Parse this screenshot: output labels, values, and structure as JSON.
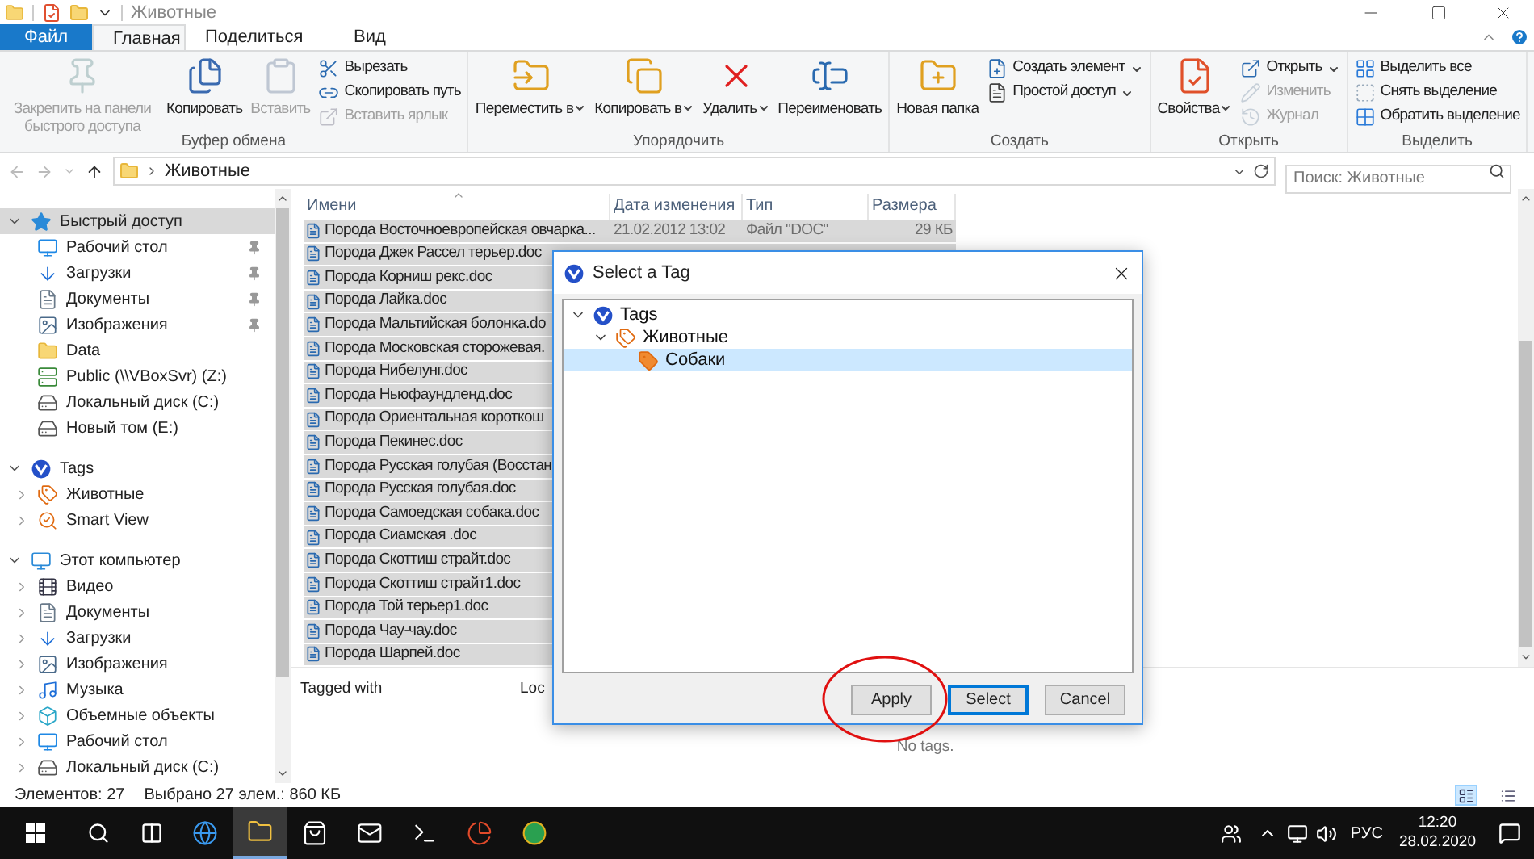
{
  "window": {
    "title": "Животные"
  },
  "tabs": [
    {
      "label": "Файл",
      "kind": "file",
      "selected": false
    },
    {
      "label": "Главная",
      "kind": "tab",
      "selected": true
    },
    {
      "label": "Поделиться",
      "kind": "tab",
      "selected": false
    },
    {
      "label": "Вид",
      "kind": "tab",
      "selected": false
    }
  ],
  "ribbon": {
    "groups": [
      {
        "label": "Буфер обмена",
        "large": [
          {
            "label": "Закрепить на панели быстрого доступа",
            "kind": "pin",
            "disabled": true,
            "dropdown": false
          },
          {
            "label": "Копировать",
            "kind": "copy",
            "disabled": false,
            "dropdown": false
          },
          {
            "label": "Вставить",
            "kind": "paste",
            "disabled": true,
            "dropdown": false
          }
        ],
        "small": [
          {
            "label": "Вырезать",
            "kind": "cut",
            "disabled": false,
            "dropdown": false
          },
          {
            "label": "Скопировать путь",
            "kind": "copypath",
            "disabled": false,
            "dropdown": false
          },
          {
            "label": "Вставить ярлык",
            "kind": "shortcut",
            "disabled": true,
            "dropdown": false
          }
        ]
      },
      {
        "label": "Упорядочить",
        "large": [
          {
            "label": "Переместить в",
            "kind": "move",
            "disabled": false,
            "dropdown": true
          },
          {
            "label": "Копировать в",
            "kind": "copyto",
            "disabled": false,
            "dropdown": true
          },
          {
            "label": "Удалить",
            "kind": "delete",
            "disabled": false,
            "dropdown": true
          },
          {
            "label": "Переименовать",
            "kind": "rename",
            "disabled": false,
            "dropdown": false
          }
        ]
      },
      {
        "label": "Создать",
        "large": [
          {
            "label": "Новая папка",
            "kind": "newfolder",
            "disabled": false,
            "dropdown": false
          }
        ],
        "small": [
          {
            "label": "Создать элемент",
            "kind": "newitem",
            "disabled": false,
            "dropdown": true
          },
          {
            "label": "Простой доступ",
            "kind": "easyaccess",
            "disabled": false,
            "dropdown": true
          }
        ]
      },
      {
        "label": "Открыть",
        "large": [
          {
            "label": "Свойства",
            "kind": "props",
            "disabled": false,
            "dropdown": true
          }
        ],
        "small": [
          {
            "label": "Открыть",
            "kind": "open",
            "disabled": false,
            "dropdown": true
          },
          {
            "label": "Изменить",
            "kind": "edit",
            "disabled": true,
            "dropdown": false
          },
          {
            "label": "Журнал",
            "kind": "history",
            "disabled": true,
            "dropdown": false
          }
        ]
      },
      {
        "label": "Выделить",
        "small": [
          {
            "label": "Выделить все",
            "kind": "selectall",
            "disabled": false,
            "dropdown": false
          },
          {
            "label": "Снять выделение",
            "kind": "selectnone",
            "disabled": false,
            "dropdown": false
          },
          {
            "label": "Обратить выделение",
            "kind": "invert",
            "disabled": false,
            "dropdown": false
          }
        ]
      }
    ]
  },
  "address_bar": {
    "path": "Животные",
    "search_placeholder": "Поиск: Животные"
  },
  "sidebar": {
    "sections": [
      {
        "label": "Быстрый доступ",
        "kind": "star",
        "expanded": true,
        "selected": true,
        "children": [
          {
            "label": "Рабочий стол",
            "kind": "desktop",
            "pinned": true
          },
          {
            "label": "Загрузки",
            "kind": "download",
            "pinned": true
          },
          {
            "label": "Документы",
            "kind": "docs",
            "pinned": true
          },
          {
            "label": "Изображения",
            "kind": "pictures",
            "pinned": true
          },
          {
            "label": "Data",
            "kind": "folder",
            "pinned": false
          },
          {
            "label": "Public (\\\\VBoxSvr) (Z:)",
            "kind": "netdrive",
            "pinned": false
          },
          {
            "label": "Локальный диск (C:)",
            "kind": "drive",
            "pinned": false
          },
          {
            "label": "Новый том (E:)",
            "kind": "drive",
            "pinned": false
          }
        ]
      },
      {
        "label": "Tags",
        "kind": "tags",
        "expanded": true,
        "selected": false,
        "children": [
          {
            "label": "Животные",
            "kind": "tagfolder",
            "expanded": false
          },
          {
            "label": "Smart View",
            "kind": "smartview",
            "expanded": false
          }
        ]
      },
      {
        "label": "Этот компьютер",
        "kind": "pc",
        "expanded": true,
        "selected": false,
        "children": [
          {
            "label": "Видео",
            "kind": "video",
            "expanded": false
          },
          {
            "label": "Документы",
            "kind": "docs",
            "expanded": false
          },
          {
            "label": "Загрузки",
            "kind": "download",
            "expanded": false
          },
          {
            "label": "Изображения",
            "kind": "pictures",
            "expanded": false
          },
          {
            "label": "Музыка",
            "kind": "music",
            "expanded": false
          },
          {
            "label": "Объемные объекты",
            "kind": "cube",
            "expanded": false
          },
          {
            "label": "Рабочий стол",
            "kind": "desktop",
            "expanded": false
          },
          {
            "label": "Локальный диск (C:)",
            "kind": "drive",
            "expanded": false
          }
        ]
      }
    ]
  },
  "file_list": {
    "columns": [
      "Имени",
      "Дата изменения",
      "Тип",
      "Размера"
    ],
    "rows": [
      {
        "name": "Порода Восточноевропейская овчарка...",
        "date": "21.02.2012 13:02",
        "type": "Файл \"DOC\"",
        "size": "29 КБ",
        "selected": true
      },
      {
        "name": "Порода Джек Рассел терьер.doc",
        "selected": true
      },
      {
        "name": "Порода Корниш рекс.doc",
        "selected": true
      },
      {
        "name": "Порода Лайка.doc",
        "selected": true
      },
      {
        "name": "Порода Мальтийская болонка.do",
        "selected": true
      },
      {
        "name": "Порода Московская сторожевая.",
        "selected": true
      },
      {
        "name": "Порода Нибелунг.doc",
        "selected": true
      },
      {
        "name": "Порода Ньюфаундленд.doc",
        "selected": true
      },
      {
        "name": "Порода Ориентальная короткош",
        "selected": true
      },
      {
        "name": "Порода Пекинес.doc",
        "selected": true
      },
      {
        "name": "Порода Русская голубая (Восстан",
        "selected": true
      },
      {
        "name": "Порода Русская голубая.doc",
        "selected": true
      },
      {
        "name": "Порода Самоедская собака.doc",
        "selected": true
      },
      {
        "name": "Порода Сиамская .doc",
        "selected": true
      },
      {
        "name": "Порода Скоттиш страйт.doc",
        "selected": true
      },
      {
        "name": "Порода Скоттиш страйт1.doc",
        "selected": true
      },
      {
        "name": "Порода Той терьер1.doc",
        "selected": true
      },
      {
        "name": "Порода Чау-чау.doc",
        "selected": true
      },
      {
        "name": "Порода Шарпей.doc",
        "selected": true
      }
    ]
  },
  "details_pane": {
    "tagged_with": "Tagged with",
    "column_2": "Loc",
    "empty_text": "No tags."
  },
  "dialog": {
    "title": "Select a Tag",
    "tree": [
      {
        "label": "Tags",
        "kind": "tags",
        "expanded": true,
        "selected": false,
        "children": [
          {
            "label": "Животные",
            "kind": "tagfolder",
            "expanded": true,
            "selected": false,
            "children": [
              {
                "label": "Собаки",
                "kind": "tag",
                "selected": true
              }
            ]
          }
        ]
      }
    ],
    "buttons": [
      {
        "label": "Apply",
        "default": false
      },
      {
        "label": "Select",
        "default": true
      },
      {
        "label": "Cancel",
        "default": false
      }
    ]
  },
  "status_bar": {
    "items_count": "Элементов: 27",
    "selection": "Выбрано 27 элем.: 860 КБ",
    "views": [
      {
        "kind": "details",
        "selected": true
      },
      {
        "kind": "tiles",
        "selected": false
      }
    ]
  },
  "taskbar": {
    "apps": [
      {
        "kind": "edge",
        "selected": false
      },
      {
        "kind": "explorer",
        "selected": true
      },
      {
        "kind": "store",
        "selected": false
      },
      {
        "kind": "mail",
        "selected": false
      },
      {
        "kind": "terminal",
        "selected": false
      },
      {
        "kind": "app",
        "selected": false
      },
      {
        "kind": "chrome",
        "selected": false
      }
    ],
    "language": "РУС",
    "time": "12:20",
    "date": "28.02.2020"
  }
}
